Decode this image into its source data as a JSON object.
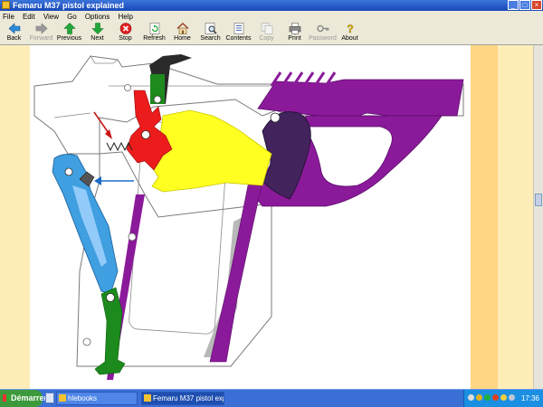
{
  "window": {
    "title": "Femaru M37 pistol explained"
  },
  "menu": [
    "File",
    "Edit",
    "View",
    "Go",
    "Options",
    "Help"
  ],
  "toolbar": [
    {
      "label": "Back",
      "icon": "back-arrow-icon",
      "enabled": true
    },
    {
      "label": "Forward",
      "icon": "forward-arrow-icon",
      "enabled": false
    },
    {
      "label": "Previous",
      "icon": "up-arrow-icon",
      "enabled": true
    },
    {
      "label": "Next",
      "icon": "down-arrow-icon",
      "enabled": true
    },
    {
      "label": "Stop",
      "icon": "stop-icon",
      "enabled": true
    },
    {
      "label": "Refresh",
      "icon": "refresh-icon",
      "enabled": true
    },
    {
      "label": "Home",
      "icon": "home-icon",
      "enabled": true
    },
    {
      "label": "Search",
      "icon": "search-icon",
      "enabled": true
    },
    {
      "label": "Contents",
      "icon": "contents-icon",
      "enabled": true
    },
    {
      "label": "Copy",
      "icon": "copy-icon",
      "enabled": false
    },
    {
      "label": "Print",
      "icon": "print-icon",
      "enabled": true
    },
    {
      "label": "Password",
      "icon": "key-icon",
      "enabled": false
    },
    {
      "label": "About",
      "icon": "help-icon",
      "enabled": true
    }
  ],
  "colors": {
    "frame": "#8b1a9a",
    "frame_dark": "#42235c",
    "slide_outline": "#7a7a7a",
    "hammer": "#ec1c1c",
    "trigger_bar": "#ffff22",
    "sear": "#1c8a1c",
    "magazine_catch": "#3f9fe0",
    "page_margin_light": "#ffedb8",
    "page_margin_dark": "#ffd684"
  },
  "taskbar": {
    "start_label": "Démarrer",
    "tasks": [
      {
        "label": "hlebooks",
        "active": false
      },
      {
        "label": "Femaru M37 pistol exp...",
        "active": true
      }
    ],
    "clock": "17:36"
  }
}
